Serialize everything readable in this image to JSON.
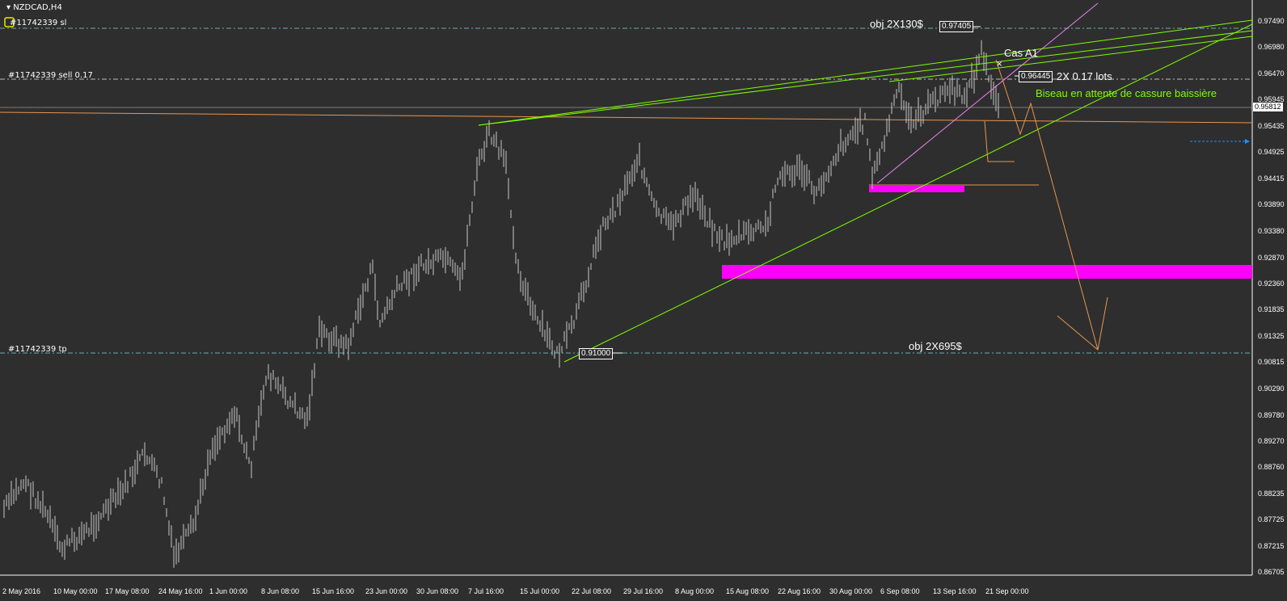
{
  "window": {
    "title": "NZDCAD,H4"
  },
  "order_lines": {
    "sl": "#11742339 sl",
    "entry": "#11742339 sell 0.17",
    "tp": "#11742339 tp"
  },
  "annotations": {
    "obj_top": "obj 2X130$",
    "obj_bottom": "obj 2X695$",
    "case": "Cas A1",
    "lots": "2X 0.17 lots",
    "pattern_note": "Biseau en attente de cassure baissière"
  },
  "price_boxes": {
    "high": "0.97405",
    "entry": "0.96445",
    "low": "0.91000"
  },
  "current_price": "0.95812",
  "price_axis": [
    "0.97490",
    "0.96980",
    "0.96470",
    "0.95945",
    "0.95435",
    "0.94925",
    "0.94415",
    "0.93890",
    "0.93380",
    "0.92870",
    "0.92360",
    "0.91835",
    "0.91325",
    "0.90815",
    "0.90290",
    "0.89780",
    "0.89270",
    "0.88760",
    "0.88235",
    "0.87725",
    "0.87215",
    "0.86705"
  ],
  "time_axis": [
    "2 May 2016",
    "10 May 00:00",
    "17 May 08:00",
    "24 May 16:00",
    "1 Jun 00:00",
    "8 Jun 08:00",
    "15 Jun 16:00",
    "23 Jun 00:00",
    "30 Jun 08:00",
    "7 Jul 16:00",
    "15 Jul 00:00",
    "22 Jul 08:00",
    "29 Jul 16:00",
    "8 Aug 00:00",
    "15 Aug 08:00",
    "22 Aug 16:00",
    "30 Aug 00:00",
    "6 Sep 08:00",
    "13 Sep 16:00",
    "21 Sep 00:00"
  ],
  "colors": {
    "background": "#2e2e2e",
    "bars": "#c8c8c8",
    "trendline": "#7fff00",
    "zone": "#ff00ff",
    "projection": "#ffa040",
    "order_line": "#9fd7d7"
  }
}
